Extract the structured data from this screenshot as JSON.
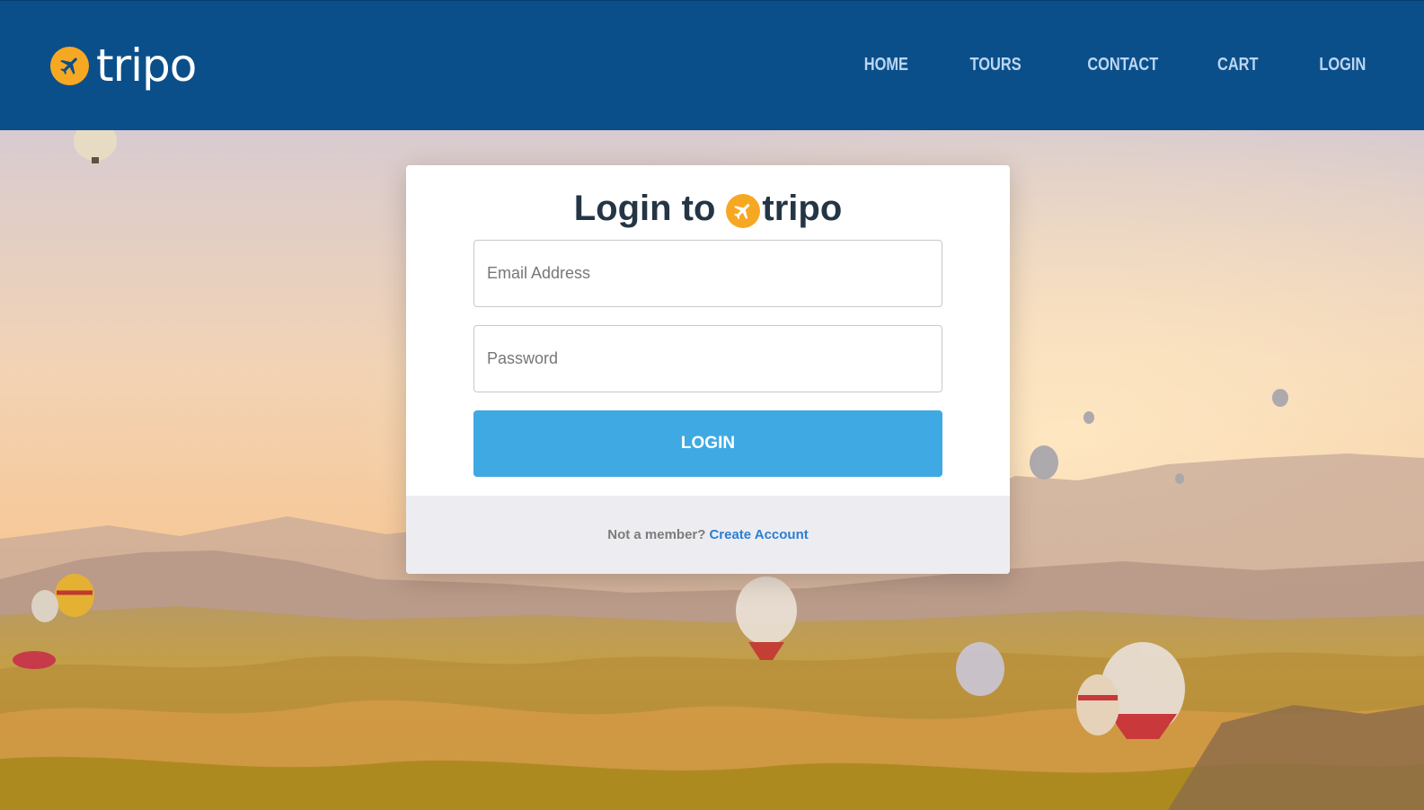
{
  "brand": {
    "name": "tripo",
    "logo_icon": "airplane-icon",
    "accent_color": "#f7a823",
    "header_color": "#0b4f8a"
  },
  "nav": {
    "items": [
      {
        "label": "HOME"
      },
      {
        "label": "TOURS"
      },
      {
        "label": "CONTACT"
      },
      {
        "label": "CART"
      },
      {
        "label": "LOGIN"
      }
    ]
  },
  "login_card": {
    "title_prefix": "Login to",
    "title_brand": "tripo",
    "email_placeholder": "Email Address",
    "password_placeholder": "Password",
    "submit_label": "LOGIN",
    "submit_color": "#3fa9e3",
    "footer_text": "Not a member?",
    "footer_link": "Create Account"
  }
}
